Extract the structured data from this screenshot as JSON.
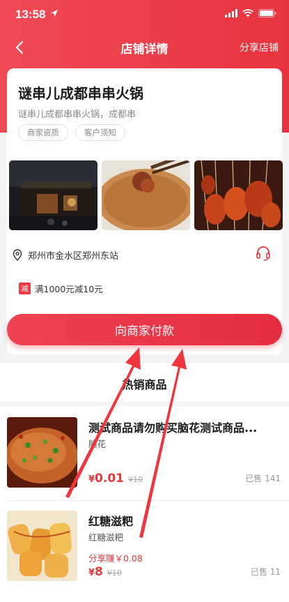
{
  "status": {
    "time": "13:58"
  },
  "nav": {
    "title": "店铺详情",
    "share": "分享店铺"
  },
  "store": {
    "name": "谜串儿成都串串火锅",
    "desc": "谜串儿成都串串火锅，成都串",
    "tags": [
      "商家资质",
      "客户须知"
    ],
    "address": "郑州市金水区郑州东站"
  },
  "promo": {
    "badge": "减",
    "text": "满1000元减10元"
  },
  "pay_button": "向商家付款",
  "hot_section": {
    "title": "热销商品",
    "products": [
      {
        "name": "测试商品请勿购买脑花测试商品...",
        "sub": "脑花",
        "share": "",
        "currency": "¥",
        "price": "0.01",
        "old_price": "¥10",
        "sold": "已售 141"
      },
      {
        "name": "红糖滋粑",
        "sub": "红糖滋粑",
        "share": "分享赚￥0.08",
        "currency": "¥",
        "price": "8",
        "old_price": "¥10",
        "sold": "已售 11"
      }
    ]
  },
  "colors": {
    "brand": "#e8343f",
    "price": "#e23a3a"
  },
  "icons": [
    "location-arrow-icon",
    "signal-icon",
    "wifi-icon",
    "battery-icon",
    "back-icon",
    "location-pin-icon",
    "headset-icon"
  ]
}
